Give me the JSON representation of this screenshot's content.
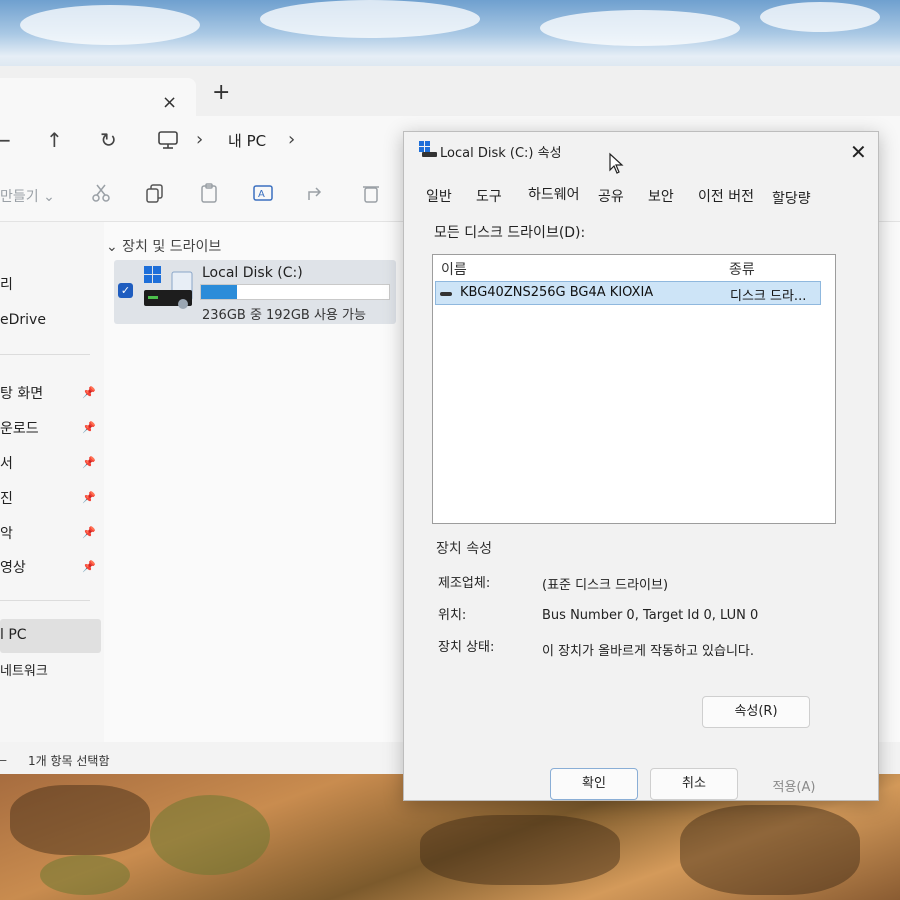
{
  "explorer": {
    "tab_close": "×",
    "tab_add": "+",
    "nav": {
      "back": "←",
      "up": "↑",
      "refresh": "↻",
      "address_current": "내 PC",
      "sep": "›"
    },
    "command_bar": {
      "new_label": "만들기 ⌄"
    },
    "sidebar": {
      "items": [
        {
          "label": "리",
          "pinned": false
        },
        {
          "label": "eDrive",
          "pinned": false
        },
        {
          "label": "탕 화면",
          "pinned": true
        },
        {
          "label": "운로드",
          "pinned": true
        },
        {
          "label": "서",
          "pinned": true
        },
        {
          "label": "진",
          "pinned": true
        },
        {
          "label": "악",
          "pinned": true
        },
        {
          "label": "영상",
          "pinned": true
        },
        {
          "label": "l PC",
          "pinned": false
        },
        {
          "label": "네트워크",
          "pinned": false
        }
      ]
    },
    "content": {
      "section_title": "⌄ 장치 및 드라이브",
      "drive": {
        "name": "Local Disk (C:)",
        "info": "236GB 중 192GB 사용 가능",
        "used_fraction": 0.19
      }
    },
    "status": {
      "count_prefix": "",
      "selection": "1개 항목 선택함"
    }
  },
  "dialog": {
    "title": "Local Disk (C:) 속성",
    "close": "✕",
    "tabs": [
      "일반",
      "도구",
      "하드웨어",
      "공유",
      "보안",
      "이전 버전",
      "할당량"
    ],
    "all_disks_label": "모든 디스크 드라이브(D):",
    "columns": {
      "name": "이름",
      "type": "종류"
    },
    "rows": [
      {
        "name": "KBG40ZNS256G BG4A KIOXIA",
        "type": "디스크 드라..."
      }
    ],
    "device_props": {
      "group_label": "장치 속성",
      "manufacturer_key": "제조업체:",
      "manufacturer_val": "(표준 디스크 드라이브)",
      "location_key": "위치:",
      "location_val": "Bus Number 0, Target Id 0, LUN 0",
      "status_key": "장치 상태:",
      "status_val": "이 장치가 올바르게 작동하고 있습니다."
    },
    "buttons": {
      "properties": "속성(R)",
      "ok": "확인",
      "cancel": "취소",
      "apply": "적용(A)"
    }
  }
}
